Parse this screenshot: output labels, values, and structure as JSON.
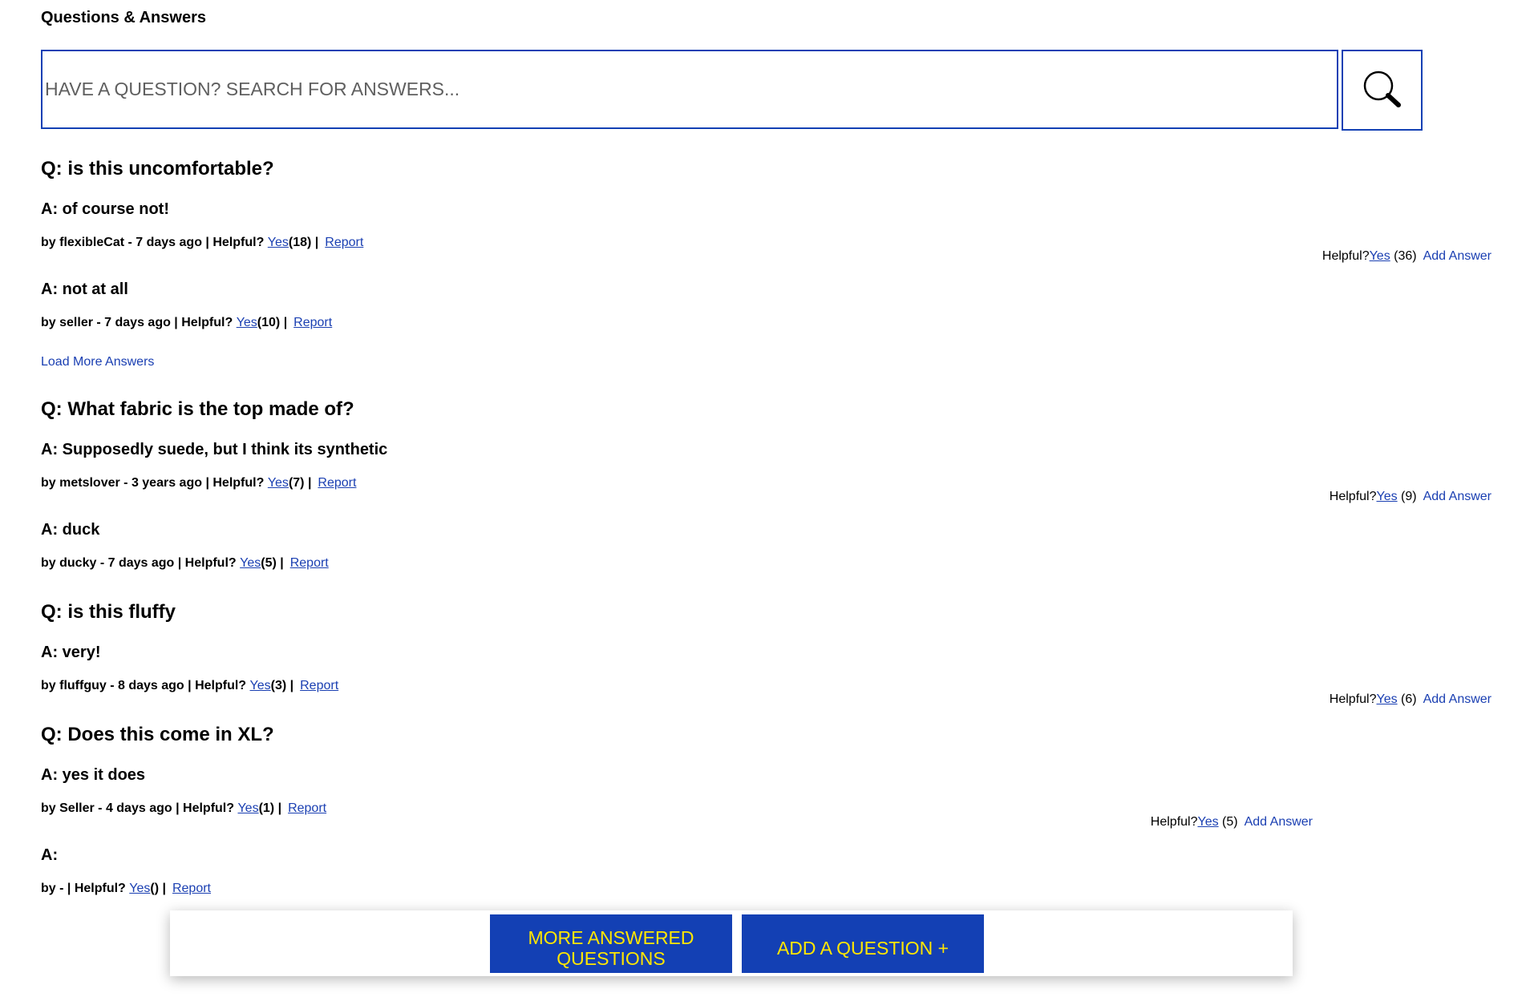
{
  "title": "Questions & Answers",
  "search": {
    "placeholder": "HAVE A QUESTION? SEARCH FOR ANSWERS...",
    "icon": "search-icon"
  },
  "labels": {
    "by_prefix": "by ",
    "helpful": "Helpful?",
    "yes": "Yes",
    "report": "Report",
    "add_answer": "Add Answer",
    "load_more_answers": "Load More Answers"
  },
  "questions": [
    {
      "question": "Q: is this uncomfortable?",
      "helpful_count": "(36)",
      "answers": [
        {
          "body": "A: of course not!",
          "author": "flexibleCat",
          "date": "7 days ago",
          "helpful_count": "(18)"
        },
        {
          "body": "A: not at all",
          "author": "seller",
          "date": "7 days ago",
          "helpful_count": "(10)"
        }
      ]
    },
    {
      "question": "Q: What fabric is the top made of?",
      "helpful_count": "(9)",
      "answers": [
        {
          "body": "A: Supposedly suede, but I think its synthetic",
          "author": "metslover",
          "date": "3 years ago",
          "helpful_count": "(7)"
        },
        {
          "body": "A: duck",
          "author": "ducky",
          "date": "7 days ago",
          "helpful_count": "(5)"
        }
      ]
    },
    {
      "question": "Q: is this fluffy",
      "helpful_count": "(6)",
      "answers": [
        {
          "body": "A: very!",
          "author": "fluffguy",
          "date": "8 days ago",
          "helpful_count": "(3)"
        }
      ]
    },
    {
      "question": "Q: Does this come in XL?",
      "helpful_count": "(5)",
      "answers": [
        {
          "body": "A: yes it does",
          "author": "Seller",
          "date": "4 days ago",
          "helpful_count": "(1)"
        },
        {
          "body": "A:",
          "author": "",
          "date": "",
          "helpful_count": "()"
        }
      ]
    }
  ],
  "footer": {
    "more_answered_questions": "MORE ANSWERED QUESTIONS",
    "add_a_question": "ADD A QUESTION +"
  },
  "colors": {
    "accent": "#1340b4",
    "button_text": "#ffe600",
    "link": "#1a3fb2"
  }
}
